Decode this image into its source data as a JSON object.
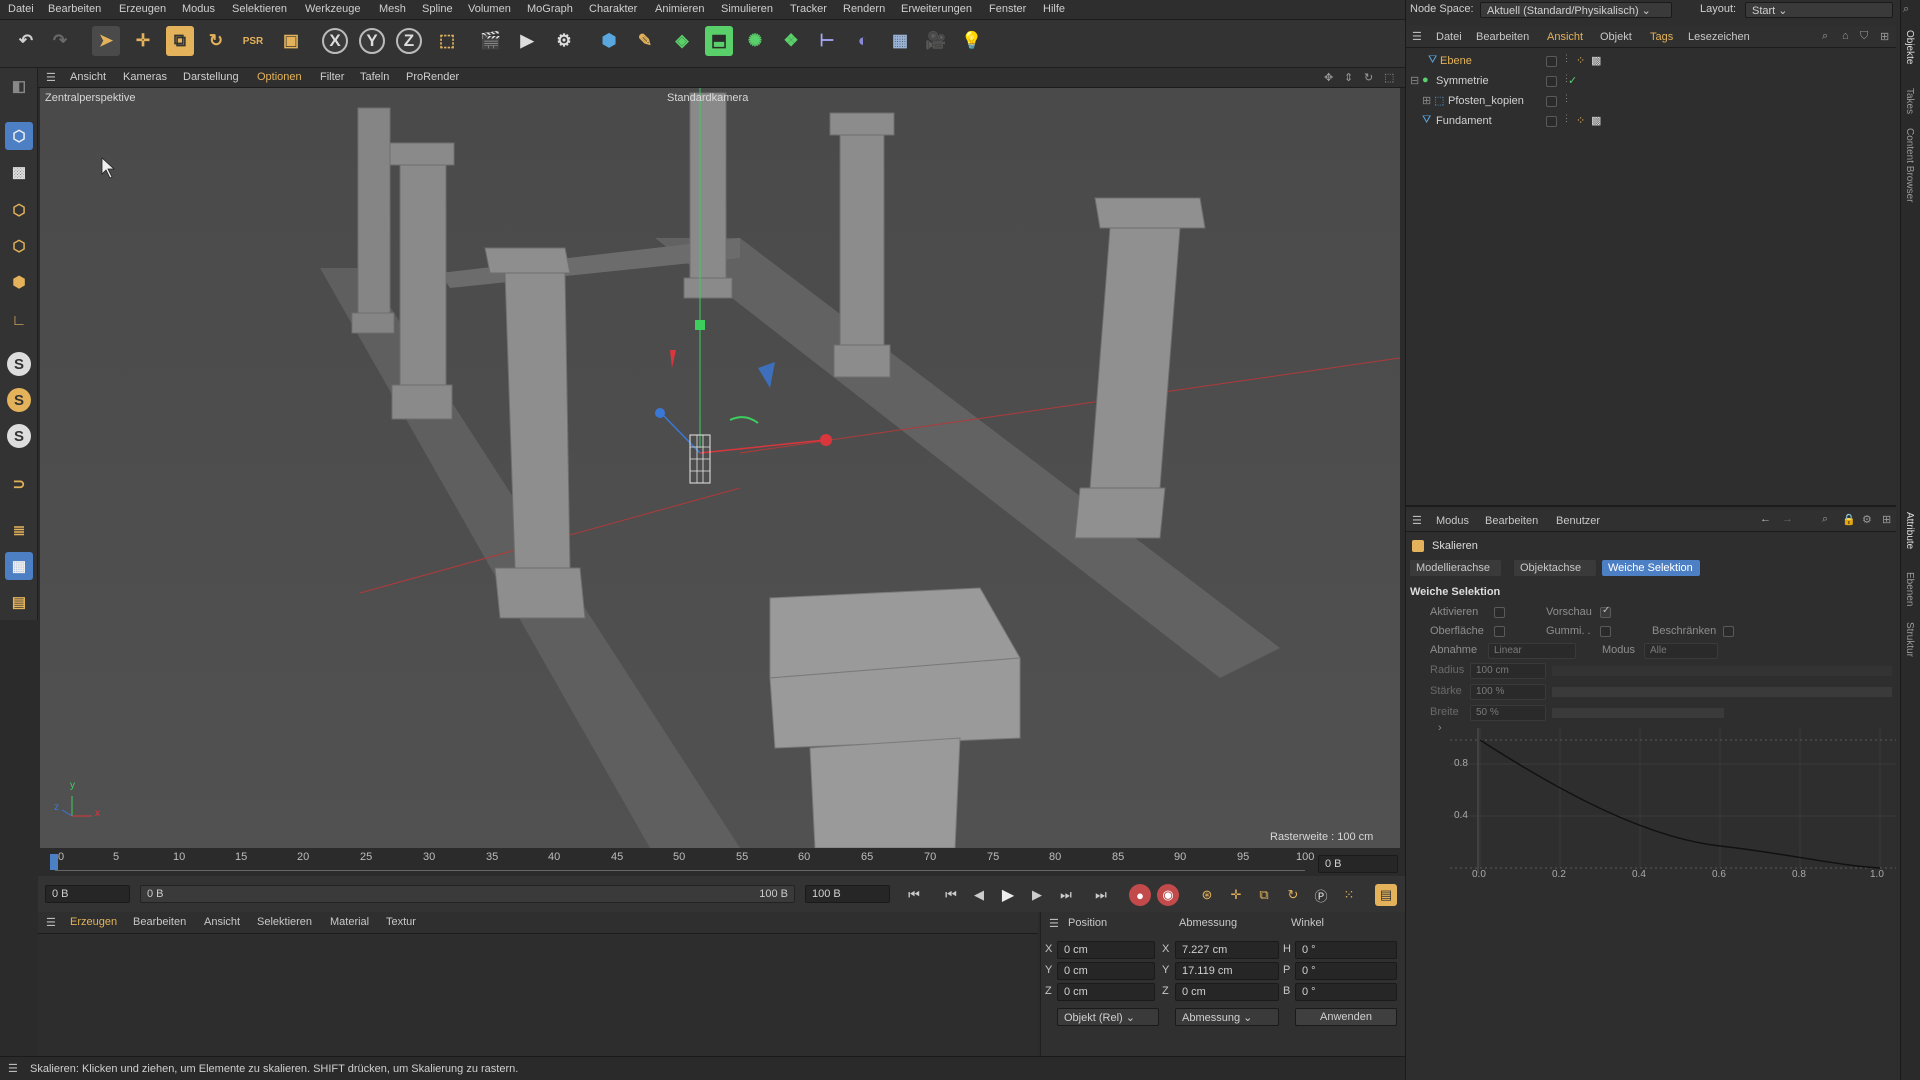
{
  "menubar": {
    "items": [
      "Datei",
      "Bearbeiten",
      "Erzeugen",
      "Modus",
      "Selektieren",
      "Werkzeuge",
      "Mesh",
      "Spline",
      "Volumen",
      "MoGraph",
      "Charakter",
      "Animieren",
      "Simulieren",
      "Tracker",
      "Rendern",
      "Erweiterungen",
      "Fenster",
      "Hilfe"
    ],
    "node_space_label": "Node Space:",
    "node_space_value": "Aktuell (Standard/Physikalisch)",
    "layout_label": "Layout:",
    "layout_value": "Start"
  },
  "toolbar": {
    "axis_x": "X",
    "axis_y": "Y",
    "axis_z": "Z",
    "icons": [
      "undo-icon",
      "redo-icon",
      "select-icon",
      "move-icon",
      "scale-icon",
      "rotate-icon",
      "psr-icon",
      "coordsys-icon",
      "lock-x-icon",
      "lock-y-icon",
      "lock-z-icon",
      "world-coord-icon",
      "render-region-icon",
      "render-view-icon",
      "render-settings-icon",
      "cube-icon",
      "pen-icon",
      "subdivision-icon",
      "extrude-icon",
      "array-icon",
      "cloner-icon",
      "deformer-icon",
      "field-icon",
      "floor-icon",
      "camera-icon",
      "light-icon"
    ]
  },
  "viewport": {
    "menu": [
      "Ansicht",
      "Kameras",
      "Darstellung",
      "Optionen",
      "Filter",
      "Tafeln",
      "ProRender"
    ],
    "active_menu": "Optionen",
    "view_label": "Zentralperspektive",
    "camera_label": "Standardkamera",
    "grid_label": "Rasterweite : 100 cm",
    "axis_x": "x",
    "axis_y": "y",
    "axis_z": "z"
  },
  "timeline": {
    "ticks": [
      "0",
      "5",
      "10",
      "15",
      "20",
      "25",
      "30",
      "35",
      "40",
      "45",
      "50",
      "55",
      "60",
      "65",
      "70",
      "75",
      "80",
      "85",
      "90",
      "95",
      "100"
    ],
    "current_frame": "0 B",
    "start_field": "0 B",
    "range_start": "0 B",
    "range_end": "100 B",
    "end_field": "100 B"
  },
  "material_menu": [
    "Erzeugen",
    "Bearbeiten",
    "Ansicht",
    "Selektieren",
    "Material",
    "Textur"
  ],
  "coords": {
    "headers": [
      "Position",
      "Abmessung",
      "Winkel"
    ],
    "rows": [
      {
        "axis": "X",
        "pos": "0 cm",
        "size_axis": "X",
        "size": "7.227 cm",
        "rot_axis": "H",
        "rot": "0 °"
      },
      {
        "axis": "Y",
        "pos": "0 cm",
        "size_axis": "Y",
        "size": "17.119 cm",
        "rot_axis": "P",
        "rot": "0 °"
      },
      {
        "axis": "Z",
        "pos": "0 cm",
        "size_axis": "Z",
        "size": "0 cm",
        "rot_axis": "B",
        "rot": "0 °"
      }
    ],
    "mode_dropdown": "Objekt (Rel)",
    "size_dropdown": "Abmessung",
    "apply_button": "Anwenden"
  },
  "status": "Skalieren: Klicken und ziehen, um Elemente zu skalieren. SHIFT drücken, um Skalierung zu rastern.",
  "object_manager": {
    "menu": [
      "Datei",
      "Bearbeiten",
      "Ansicht",
      "Objekt",
      "Tags",
      "Lesezeichen"
    ],
    "objects": [
      {
        "name": "Ebene",
        "selected": true
      },
      {
        "name": "Symmetrie",
        "selected": false
      },
      {
        "name": "Pfosten_kopien",
        "selected": false
      },
      {
        "name": "Fundament",
        "selected": false
      }
    ]
  },
  "attributes": {
    "menu": [
      "Modus",
      "Bearbeiten",
      "Benutzer"
    ],
    "tool_title": "Skalieren",
    "tabs": [
      "Modellierachse",
      "Objektachse",
      "Weiche Selektion"
    ],
    "active_tab": "Weiche Selektion",
    "section_title": "Weiche Selektion",
    "aktivieren": "Aktivieren",
    "vorschau": "Vorschau",
    "oberflaeche": "Oberfläche",
    "gummi": "Gummi. .",
    "beschraenken": "Beschränken",
    "abnahme_label": "Abnahme",
    "abnahme_value": "Linear",
    "modus_label": "Modus",
    "modus_value": "Alle",
    "radius_label": "Radius",
    "radius_value": "100 cm",
    "staerke_label": "Stärke",
    "staerke_value": "100 %",
    "breite_label": "Breite",
    "breite_value": "50 %",
    "curve_y_ticks": [
      "0.8",
      "0.4"
    ],
    "curve_x_ticks": [
      "0.0",
      "0.2",
      "0.4",
      "0.6",
      "0.8",
      "1.0"
    ]
  },
  "side_tabs": [
    "Objekte",
    "Takes",
    "Content Browser",
    "Attribute",
    "Ebenen",
    "Struktur"
  ],
  "colors": {
    "accent": "#e3b25a",
    "active_tab": "#4d7fc4",
    "x_axis": "#d9363e",
    "y_axis": "#3ccf5e",
    "z_axis": "#3a78d8"
  }
}
